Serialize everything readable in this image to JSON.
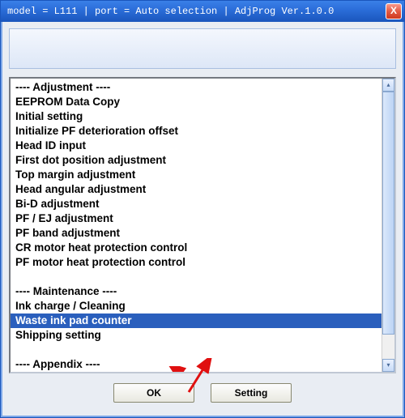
{
  "titlebar": {
    "text": "model = L111 | port = Auto selection | AdjProg Ver.1.0.0",
    "close_label": "X"
  },
  "list": {
    "items": [
      {
        "label": "---- Adjustment ----",
        "type": "sep"
      },
      {
        "label": "EEPROM Data Copy",
        "type": "item"
      },
      {
        "label": "Initial setting",
        "type": "item"
      },
      {
        "label": "Initialize PF deterioration offset",
        "type": "item"
      },
      {
        "label": "Head ID input",
        "type": "item"
      },
      {
        "label": "First dot position adjustment",
        "type": "item"
      },
      {
        "label": "Top margin adjustment",
        "type": "item"
      },
      {
        "label": "Head angular adjustment",
        "type": "item"
      },
      {
        "label": "Bi-D adjustment",
        "type": "item"
      },
      {
        "label": "PF / EJ adjustment",
        "type": "item"
      },
      {
        "label": "PF band adjustment",
        "type": "item"
      },
      {
        "label": "CR motor heat protection control",
        "type": "item"
      },
      {
        "label": "PF motor heat protection control",
        "type": "item"
      },
      {
        "label": "",
        "type": "blank"
      },
      {
        "label": "---- Maintenance ----",
        "type": "sep"
      },
      {
        "label": "Ink charge / Cleaning",
        "type": "item"
      },
      {
        "label": "Waste ink pad counter",
        "type": "item",
        "selected": true
      },
      {
        "label": "Shipping setting",
        "type": "item"
      },
      {
        "label": "",
        "type": "blank"
      },
      {
        "label": "---- Appendix ----",
        "type": "sep"
      }
    ]
  },
  "buttons": {
    "ok_label": "OK",
    "setting_label": "Setting"
  },
  "scroll": {
    "up_glyph": "▴",
    "down_glyph": "▾"
  },
  "annotations": {
    "arrow_color": "#e01010"
  }
}
